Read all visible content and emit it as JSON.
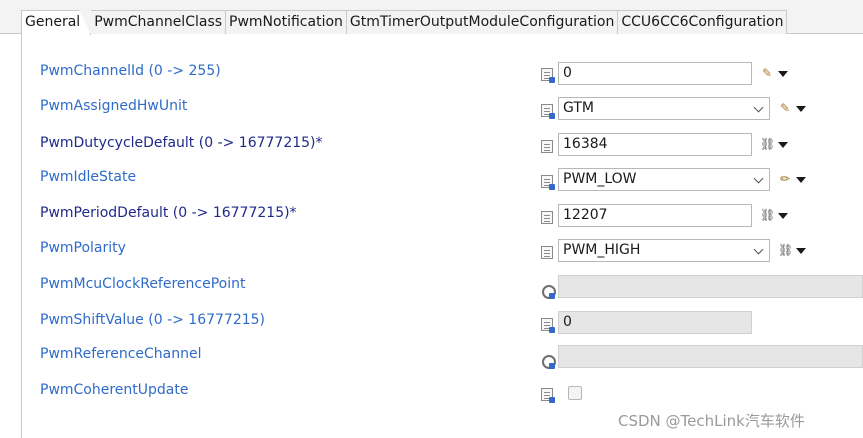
{
  "tabs": [
    {
      "label": "General"
    },
    {
      "label": "PwmChannelClass"
    },
    {
      "label": "PwmNotification"
    },
    {
      "label": "GtmTimerOutputModuleConfiguration"
    },
    {
      "label": "CCU6CC6Configuration"
    }
  ],
  "fields": [
    {
      "label": "PwmChannelId (0 -> 255)",
      "value": "0"
    },
    {
      "label": "PwmAssignedHwUnit",
      "value": "GTM"
    },
    {
      "label": "PwmDutycycleDefault (0 -> 16777215)*",
      "value": "16384"
    },
    {
      "label": "PwmIdleState",
      "value": "PWM_LOW"
    },
    {
      "label": "PwmPeriodDefault (0 -> 16777215)*",
      "value": "12207"
    },
    {
      "label": "PwmPolarity",
      "value": "PWM_HIGH"
    },
    {
      "label": "PwmMcuClockReferencePoint",
      "value": ""
    },
    {
      "label": "PwmShiftValue (0 -> 16777215)",
      "value": "0"
    },
    {
      "label": "PwmReferenceChannel",
      "value": ""
    },
    {
      "label": "PwmCoherentUpdate",
      "value": ""
    }
  ],
  "watermark": "CSDN @TechLink汽车软件",
  "colors": {
    "label": "#2f6bc8",
    "required_label": "#1f2a8a",
    "disabled_field": "#e6e6e6"
  }
}
